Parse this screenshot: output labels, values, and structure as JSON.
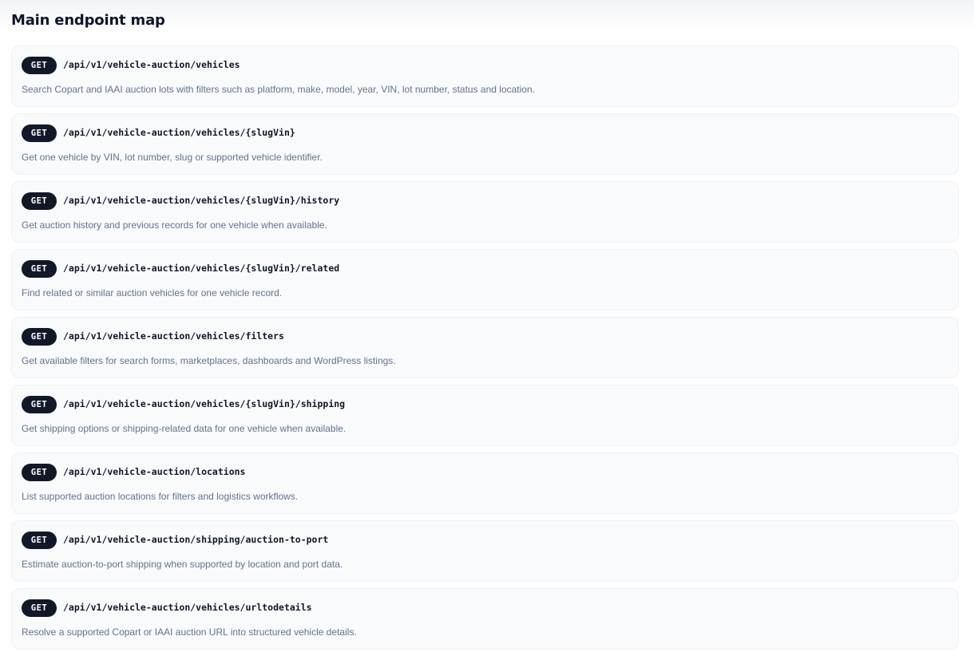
{
  "section": {
    "title": "Main endpoint map"
  },
  "endpoints": [
    {
      "method": "GET",
      "path": "/api/v1/vehicle-auction/vehicles",
      "description": "Search Copart and IAAI auction lots with filters such as platform, make, model, year, VIN, lot number, status and location."
    },
    {
      "method": "GET",
      "path": "/api/v1/vehicle-auction/vehicles/{slugVin}",
      "description": "Get one vehicle by VIN, lot number, slug or supported vehicle identifier."
    },
    {
      "method": "GET",
      "path": "/api/v1/vehicle-auction/vehicles/{slugVin}/history",
      "description": "Get auction history and previous records for one vehicle when available."
    },
    {
      "method": "GET",
      "path": "/api/v1/vehicle-auction/vehicles/{slugVin}/related",
      "description": "Find related or similar auction vehicles for one vehicle record."
    },
    {
      "method": "GET",
      "path": "/api/v1/vehicle-auction/vehicles/filters",
      "description": "Get available filters for search forms, marketplaces, dashboards and WordPress listings."
    },
    {
      "method": "GET",
      "path": "/api/v1/vehicle-auction/vehicles/{slugVin}/shipping",
      "description": "Get shipping options or shipping-related data for one vehicle when available."
    },
    {
      "method": "GET",
      "path": "/api/v1/vehicle-auction/locations",
      "description": "List supported auction locations for filters and logistics workflows."
    },
    {
      "method": "GET",
      "path": "/api/v1/vehicle-auction/shipping/auction-to-port",
      "description": "Estimate auction-to-port shipping when supported by location and port data."
    },
    {
      "method": "GET",
      "path": "/api/v1/vehicle-auction/vehicles/urltodetails",
      "description": "Resolve a supported Copart or IAAI auction URL into structured vehicle details."
    }
  ]
}
